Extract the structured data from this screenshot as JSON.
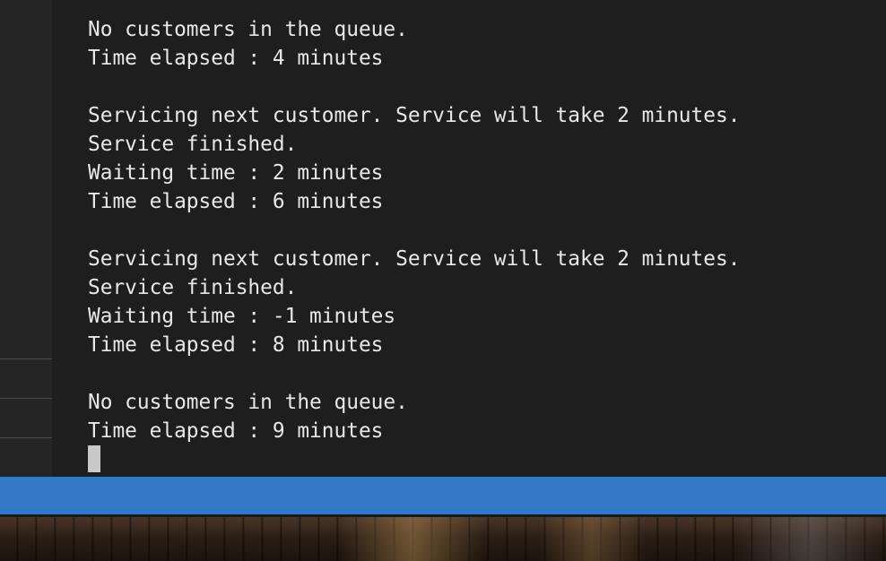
{
  "terminal": {
    "lines": [
      "No customers in the queue.",
      "Time elapsed : 4 minutes",
      "",
      "Servicing next customer. Service will take 2 minutes.",
      "Service finished.",
      "Waiting time : 2 minutes",
      "Time elapsed : 6 minutes",
      "",
      "Servicing next customer. Service will take 2 minutes.",
      "Service finished.",
      "Waiting time : -1 minutes",
      "Time elapsed : 8 minutes",
      "",
      "No customers in the queue.",
      "Time elapsed : 9 minutes"
    ]
  },
  "colors": {
    "terminal_background": "#1e1e1e",
    "terminal_text": "#e8e8e8",
    "status_bar": "#3478c6",
    "sidebar": "#252526"
  }
}
